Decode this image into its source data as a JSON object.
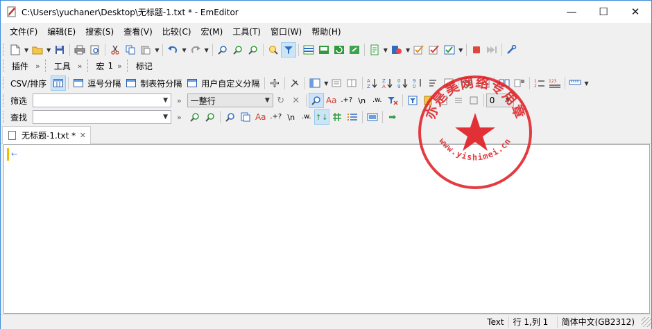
{
  "window": {
    "title": "C:\\Users\\yuchaner\\Desktop\\无标题-1.txt * - EmEditor",
    "minimize": "—",
    "maximize": "☐",
    "close": "✕"
  },
  "menu": [
    "文件(F)",
    "编辑(E)",
    "搜索(S)",
    "查看(V)",
    "比较(C)",
    "宏(M)",
    "工具(T)",
    "窗口(W)",
    "帮助(H)"
  ],
  "bars": {
    "plugins": "插件",
    "tools": "工具",
    "macro": "宏",
    "macro_suffix": "1",
    "bookmarks": "标记",
    "chevron": "»"
  },
  "csv": {
    "label": "CSV/排序",
    "comma": "逗号分隔",
    "tab": "制表符分隔",
    "custom": "用户自定义分隔"
  },
  "filter": {
    "label": "筛选",
    "value": "",
    "scope": "一整行",
    "count": "0"
  },
  "find": {
    "label": "查找",
    "value": ""
  },
  "glyphs": {
    "Aa": "Aa",
    "regex": ".+?",
    "newline": "\\n",
    "word": ".w."
  },
  "tabs": [
    {
      "title": "无标题-1.txt *",
      "close": "✕"
    }
  ],
  "editor": {
    "eol": "←"
  },
  "status": {
    "mode": "Text",
    "position": "行 1,列 1",
    "encoding": "简体中文(GB2312)"
  },
  "watermark": {
    "text_top": "亦是美网络专用章",
    "text_bottom": "www.yishimei.cn",
    "color": "#e0262b"
  }
}
